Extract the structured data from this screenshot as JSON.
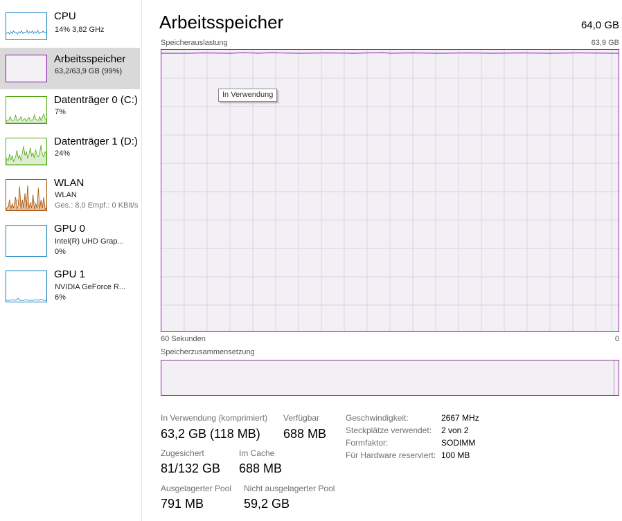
{
  "sidebar": {
    "items": [
      {
        "title": "CPU",
        "sub1": "14% 3,82 GHz",
        "sub2": ""
      },
      {
        "title": "Arbeitsspeicher",
        "sub1": "63,2/63,9 GB (99%)",
        "sub2": ""
      },
      {
        "title": "Datenträger 0 (C:)",
        "sub1": "7%",
        "sub2": ""
      },
      {
        "title": "Datenträger 1 (D:)",
        "sub1": "24%",
        "sub2": ""
      },
      {
        "title": "WLAN",
        "sub1": "WLAN",
        "sub2": "Ges.: 8,0  Empf.: 0 KBit/s"
      },
      {
        "title": "GPU 0",
        "sub1": "Intel(R) UHD Grap...",
        "sub2": "0%"
      },
      {
        "title": "GPU 1",
        "sub1": "NVIDIA GeForce R...",
        "sub2": "6%"
      }
    ],
    "selected_index": 1
  },
  "colors": {
    "cpu": "#117dbb",
    "memory": "#8b12ae",
    "disk": "#4da60c",
    "network": "#a74f01",
    "gpu": "#117dbb",
    "graph_background": "#f2eff5",
    "grid": "#dcd3e1"
  },
  "main": {
    "title": "Arbeitsspeicher",
    "total": "64,0 GB",
    "usage_label": "Speicherauslastung",
    "usage_max": "63,9 GB",
    "tooltip": "In Verwendung",
    "time_left": "60 Sekunden",
    "time_right": "0",
    "composition_label": "Speicherzusammensetzung",
    "usage_fraction": 0.99
  },
  "stats": {
    "in_use_label": "In Verwendung (komprimiert)",
    "in_use_value": "63,2 GB (118 MB)",
    "available_label": "Verfügbar",
    "available_value": "688 MB",
    "committed_label": "Zugesichert",
    "committed_value": "81/132 GB",
    "cached_label": "Im Cache",
    "cached_value": "688 MB",
    "paged_label": "Ausgelagerter Pool",
    "paged_value": "791 MB",
    "nonpaged_label": "Nicht ausgelagerter Pool",
    "nonpaged_value": "59,2 GB"
  },
  "properties": [
    {
      "label": "Geschwindigkeit:",
      "value": "2667 MHz"
    },
    {
      "label": "Steckplätze verwendet:",
      "value": "2 von 2"
    },
    {
      "label": "Formfaktor:",
      "value": "SODIMM"
    },
    {
      "label": "Für Hardware reserviert:",
      "value": "100 MB"
    }
  ]
}
